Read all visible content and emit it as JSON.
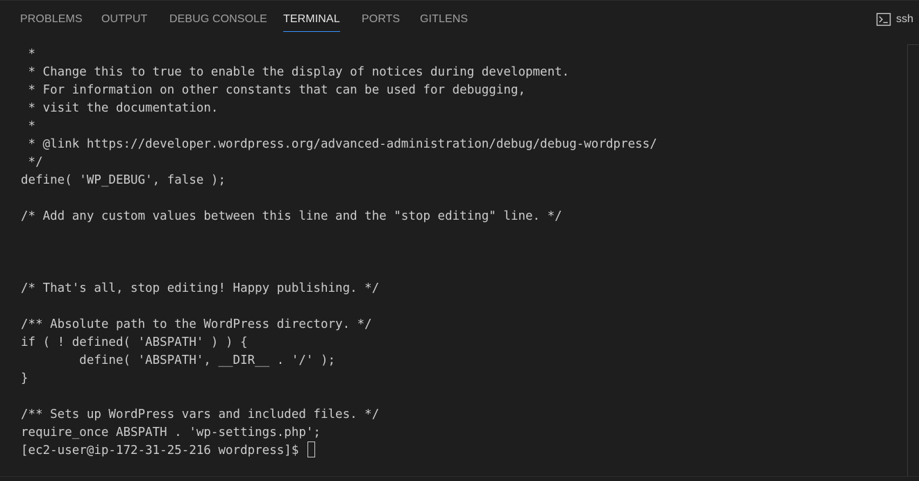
{
  "panel": {
    "tabs": [
      {
        "label": "PROBLEMS"
      },
      {
        "label": "OUTPUT"
      },
      {
        "label": "DEBUG CONSOLE"
      },
      {
        "label": "TERMINAL"
      },
      {
        "label": "PORTS"
      },
      {
        "label": "GITLENS"
      }
    ],
    "active_tab": "TERMINAL",
    "shell_label": "ssh",
    "shell_icon": "terminal-icon"
  },
  "terminal": {
    "lines": [
      " *",
      " * Change this to true to enable the display of notices during development.",
      " * For information on other constants that can be used for debugging,",
      " * visit the documentation.",
      " *",
      " * @link https://developer.wordpress.org/advanced-administration/debug/debug-wordpress/",
      " */",
      "define( 'WP_DEBUG', false );",
      "",
      "/* Add any custom values between this line and the \"stop editing\" line. */",
      "",
      "",
      "",
      "/* That's all, stop editing! Happy publishing. */",
      "",
      "/** Absolute path to the WordPress directory. */",
      "if ( ! defined( 'ABSPATH' ) ) {",
      "        define( 'ABSPATH', __DIR__ . '/' );",
      "}",
      "",
      "/** Sets up WordPress vars and included files. */",
      "require_once ABSPATH . 'wp-settings.php';"
    ],
    "prompt": "[ec2-user@ip-172-31-25-216 wordpress]$ "
  },
  "colors": {
    "background": "#1e1e1e",
    "text": "#cccccc",
    "tab_inactive": "#a0a0a0",
    "tab_active": "#e7e7e7",
    "accent": "#3794ff"
  }
}
